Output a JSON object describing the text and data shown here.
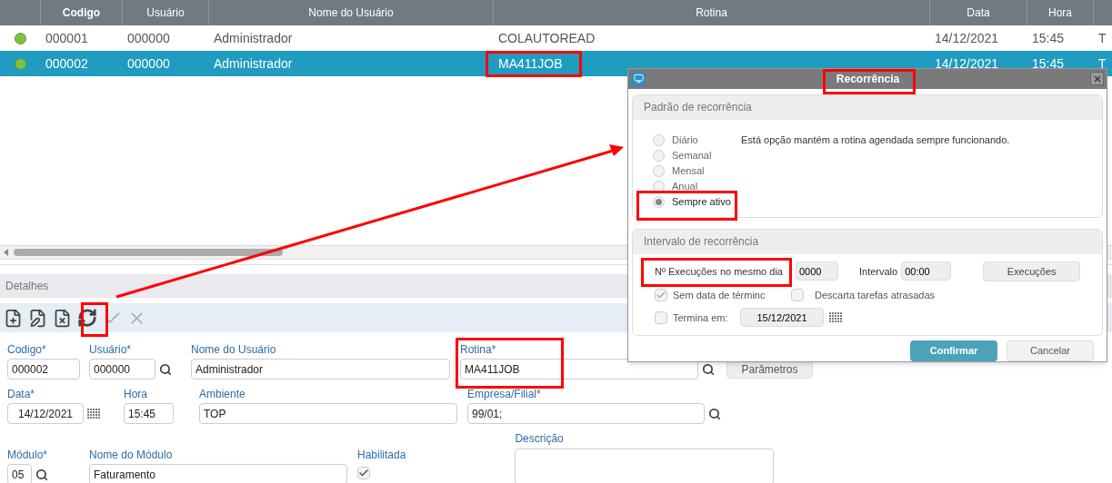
{
  "table": {
    "columns": [
      {
        "label": "Codigo",
        "sorted": true
      },
      {
        "label": "Usuário",
        "sorted": false
      },
      {
        "label": "Nome do Usuário",
        "sorted": false
      },
      {
        "label": "Rotina",
        "sorted": false
      },
      {
        "label": "Data",
        "sorted": false
      },
      {
        "label": "Hora",
        "sorted": false
      }
    ],
    "rows": [
      {
        "selected": false,
        "color": "#7cc242",
        "cells": [
          "000001",
          "000000",
          "Administrador",
          "COLAUTOREAD",
          "14/12/2021",
          "15:45",
          "T"
        ]
      },
      {
        "selected": true,
        "color": "#7cc242",
        "cells": [
          "000002",
          "000000",
          "Administrador",
          "MA411JOB",
          "14/12/2021",
          "15:45",
          "T"
        ]
      }
    ]
  },
  "details": {
    "title": "Detalhes",
    "toolbar": [
      {
        "kind": "add",
        "disabled": false
      },
      {
        "kind": "edit",
        "disabled": false
      },
      {
        "kind": "delete",
        "disabled": false
      },
      {
        "kind": "refresh",
        "disabled": false
      },
      {
        "kind": "confirm",
        "disabled": true
      },
      {
        "kind": "cancel",
        "disabled": true
      }
    ],
    "rows": [
      [
        {
          "kind": "text",
          "label": "Codigo*",
          "value": "000002"
        },
        {
          "kind": "lookup",
          "label": "Usuário*",
          "value": "000000"
        },
        {
          "kind": "text",
          "label": "Nome do Usuário",
          "value": "Administrador"
        },
        {
          "kind": "lookup",
          "label": "Rotina*",
          "value": "MA411JOB"
        },
        {
          "kind": "button",
          "label": "Parâmetros"
        }
      ],
      [
        {
          "kind": "date",
          "label": "Data*",
          "value": "14/12/2021"
        },
        {
          "kind": "text",
          "label": "Hora",
          "value": "15:45"
        },
        {
          "kind": "text",
          "label": "Ambiente",
          "value": "TOP"
        },
        {
          "kind": "lookup",
          "label": "Empresa/Filial*",
          "value": "99/01;"
        }
      ],
      [
        {
          "kind": "lookup",
          "label": "Módulo*",
          "value": "05"
        },
        {
          "kind": "text",
          "label": "Nome do Módulo",
          "value": "Faturamento"
        },
        {
          "kind": "checkbox",
          "label": "Habilitada",
          "checked": true
        },
        {
          "kind": "textarea",
          "label": "Descrição"
        }
      ]
    ]
  },
  "dialog": {
    "title": "Recorrência",
    "pattern": {
      "title": "Padrão de recorrência",
      "options": [
        {
          "label": "Diário",
          "selected": false
        },
        {
          "label": "Semanal",
          "selected": false
        },
        {
          "label": "Mensal",
          "selected": false
        },
        {
          "label": "Anual",
          "selected": false
        },
        {
          "label": "Sempre ativo",
          "selected": true
        }
      ],
      "description": "Está opção mantém a rotina agendada sempre funcionando."
    },
    "interval": {
      "title": "Intervalo de recorrência",
      "executions_label": "Nº Execuções no mesmo dia",
      "executions_value": "0000",
      "interval_label": "Intervalo",
      "interval_value": "00:00",
      "executions_button": "Execuções",
      "no_end_date": {
        "label": "Sem data de términc",
        "checked": true
      },
      "discard_late": {
        "label": "Descarta tarefas atrasadas",
        "checked": false
      },
      "ends_on": {
        "label": "Termina em:",
        "checked": false,
        "value": "15/12/2021"
      }
    },
    "buttons": [
      {
        "kind": "primary",
        "label": "Confirmar"
      },
      {
        "kind": "secondary",
        "label": "Cancelar"
      }
    ]
  }
}
